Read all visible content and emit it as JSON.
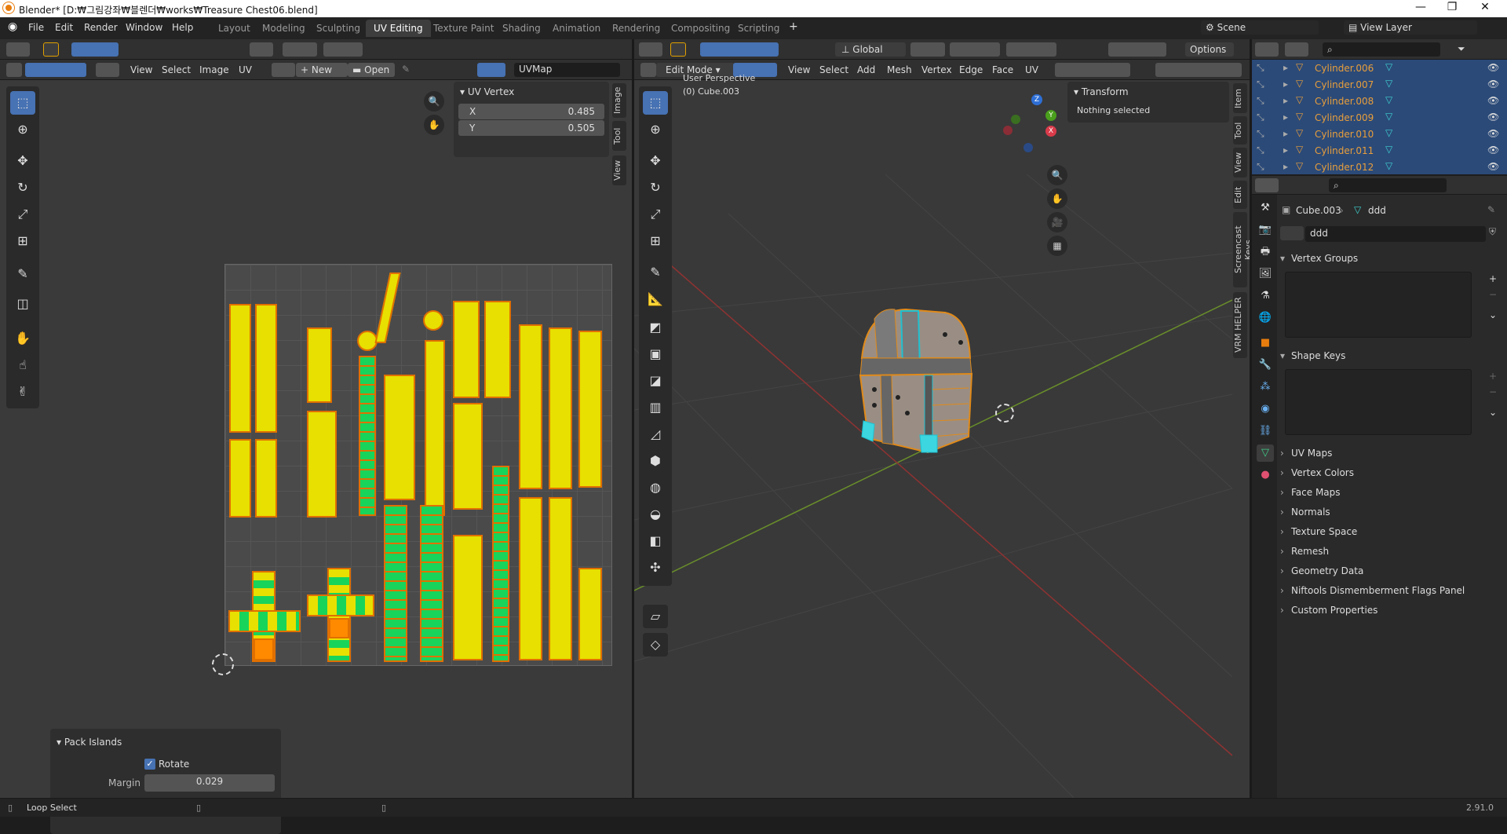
{
  "window": {
    "title": "Blender* [D:₩그림강좌₩블렌더₩works₩Treasure Chest06.blend]"
  },
  "menu": [
    "File",
    "Edit",
    "Render",
    "Window",
    "Help"
  ],
  "workspaces": [
    "Layout",
    "Modeling",
    "Sculpting",
    "UV Editing",
    "Texture Paint",
    "Shading",
    "Animation",
    "Rendering",
    "Compositing",
    "Scripting"
  ],
  "scene": {
    "name": "Scene",
    "view_layer": "View Layer"
  },
  "uv_editor": {
    "menus": [
      "View",
      "Select",
      "Image",
      "UV"
    ],
    "new_label": "New",
    "open_label": "Open",
    "uvmap": "UVMap",
    "panel_title": "UV Vertex",
    "x_label": "X",
    "x_value": "0.485",
    "y_label": "Y",
    "y_value": "0.505",
    "tabs": [
      "Image",
      "Tool",
      "View"
    ]
  },
  "pack_islands": {
    "title": "Pack Islands",
    "rotate_label": "Rotate",
    "rotate_checked": true,
    "margin_label": "Margin",
    "margin_value": "0.029"
  },
  "viewport": {
    "mode": "Edit Mode",
    "menus": [
      "View",
      "Select",
      "Add",
      "Mesh",
      "Vertex",
      "Edge",
      "Face",
      "UV"
    ],
    "orientation": "Global",
    "options": "Options",
    "persp": "User Perspective",
    "object": "(0) Cube.003",
    "transform_title": "Transform",
    "nothing_selected": "Nothing selected",
    "tabs": [
      "Item",
      "Tool",
      "View",
      "Edit",
      "Screencast Keys",
      "VRM HELPER"
    ]
  },
  "outliner": {
    "items": [
      "Cylinder.006",
      "Cylinder.007",
      "Cylinder.008",
      "Cylinder.009",
      "Cylinder.010",
      "Cylinder.011",
      "Cylinder.012"
    ]
  },
  "properties": {
    "object": "Cube.003",
    "mesh": "ddd",
    "data_name": "ddd",
    "vertex_groups": "Vertex Groups",
    "shape_keys": "Shape Keys",
    "collapsed": [
      "UV Maps",
      "Vertex Colors",
      "Face Maps",
      "Normals",
      "Texture Space",
      "Remesh",
      "Geometry Data",
      "Niftools Dismemberment Flags Panel",
      "Custom Properties"
    ]
  },
  "status": {
    "left": "Loop Select",
    "version": "2.91.0"
  },
  "colors": {
    "accent": "#4772b3",
    "orange": "#e87d0d",
    "uv_yellow": "#e8e000",
    "uv_green": "#19d45a"
  }
}
